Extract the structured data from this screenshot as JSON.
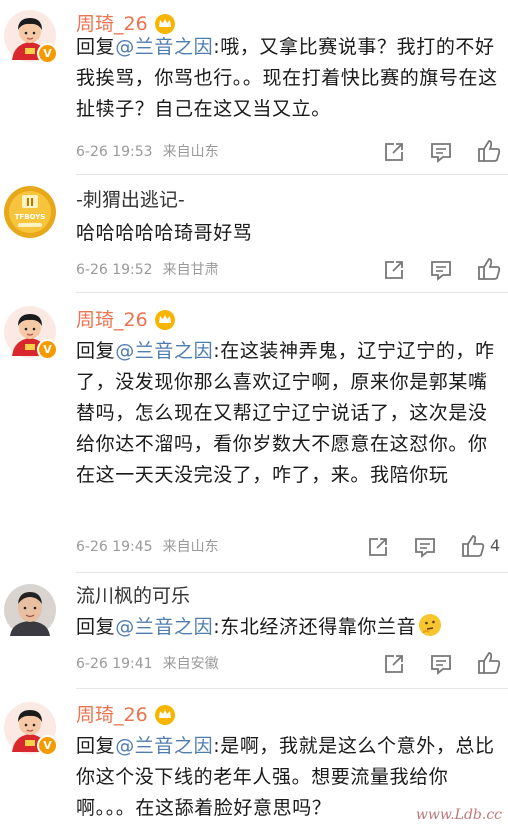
{
  "comments": [
    {
      "author": "周琦_26",
      "reply_prefix": "回复",
      "mention": "@兰音之因",
      "text": ":哦，又拿比赛说事？我打的不好我挨骂，你骂也行。。现在打着快比赛的旗号在这扯犊子？自己在这又当又立。",
      "time": "6-26 19:53",
      "source": "来自山东",
      "likes": ""
    },
    {
      "author": "-刺猬出逃记-",
      "text": "哈哈哈哈哈琦哥好骂",
      "time": "6-26 19:52",
      "source": "来自甘肃",
      "likes": "",
      "avatar_text": "TFBOYS"
    },
    {
      "author": "周琦_26",
      "reply_prefix": "回复",
      "mention": "@兰音之因",
      "text": ":在这装神弄鬼，辽宁辽宁的，咋了，没发现你那么喜欢辽宁啊，原来你是郭某嘴替吗，怎么现在又帮辽宁辽宁说话了，这次是没给你达不溜吗，看你岁数大不愿意在这怼你。你在这一天天没完没了，咋了，来。我陪你玩",
      "time": "6-26 19:45",
      "source": "来自山东",
      "likes": "4"
    },
    {
      "author": "流川枫的可乐",
      "reply_prefix": "回复",
      "mention": "@兰音之因",
      "text": ":东北经济还得靠你兰音",
      "time": "6-26 19:41",
      "source": "来自安徽",
      "likes": ""
    },
    {
      "author": "周琦_26",
      "reply_prefix": "回复",
      "mention": "@兰音之因",
      "text": ":是啊，我就是这么个意外，总比你这个没下线的老年人强。想要流量我给你啊。。。在这舔着脸好意思吗？",
      "time": "",
      "source": "",
      "likes": ""
    }
  ],
  "watermark": "www.Ldb.cc",
  "colors": {
    "author_vip": "#eb7350",
    "mention": "#507daf",
    "meta": "#9a9a9a"
  },
  "icons": [
    "crown-icon",
    "share-icon",
    "comment-icon",
    "like-icon",
    "verified-badge-icon"
  ]
}
